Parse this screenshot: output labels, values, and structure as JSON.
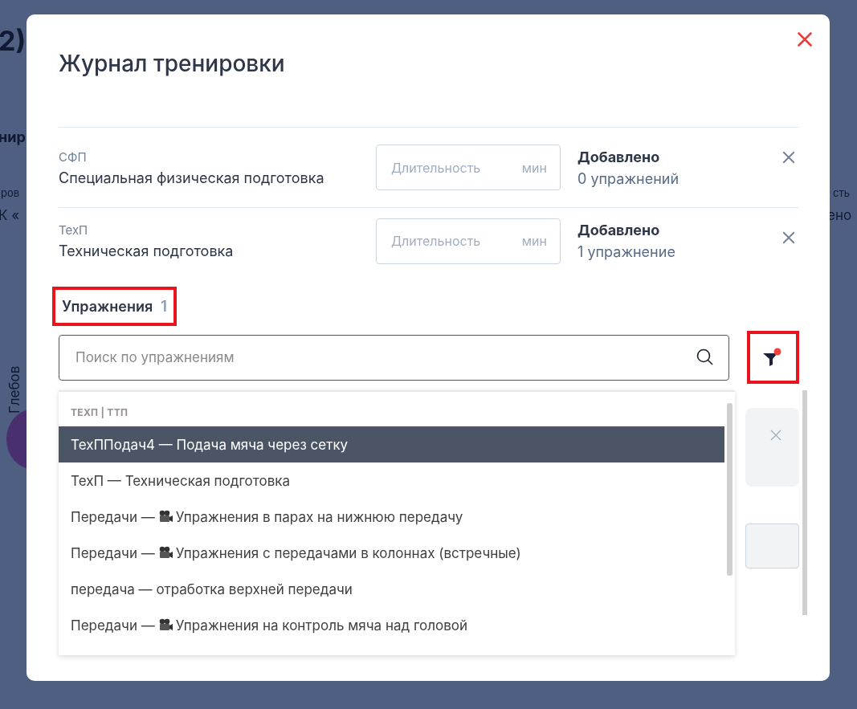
{
  "background": {
    "texts": [
      {
        "text": "2)",
        "kind": "heading"
      },
      {
        "text": "нир",
        "kind": "bold"
      },
      {
        "text": "ров",
        "kind": "label"
      },
      {
        "text": "К «",
        "kind": "value"
      },
      {
        "text": "сть",
        "kind": "label"
      },
      {
        "text": "ено",
        "kind": "value"
      },
      {
        "text": "Глебов",
        "kind": "vertical"
      }
    ]
  },
  "dialog": {
    "title": "Журнал тренировки",
    "sections": [
      {
        "code": "СФП",
        "name": "Специальная физическая подготовка",
        "duration": {
          "placeholder": "Длительность",
          "unit": "мин"
        },
        "status": "Добавлено",
        "count": "0 упражнений"
      },
      {
        "code": "ТехП",
        "name": "Техническая подготовка",
        "duration": {
          "placeholder": "Длительность",
          "unit": "мин"
        },
        "status": "Добавлено",
        "count": "1 упражнение"
      }
    ],
    "exercises": {
      "title": "Упражнения",
      "count": "1",
      "highlighted": true,
      "search": {
        "placeholder": "Поиск по упражнениям"
      },
      "filter": {
        "active": true,
        "highlighted": true
      },
      "dropdown": {
        "group": "ТЕХП | ТТП",
        "items": [
          {
            "lead": "ТехППодач4 —",
            "camera": false,
            "text": "Подача мяча через сетку",
            "selected": true
          },
          {
            "lead": "ТехП —",
            "camera": false,
            "text": "Техническая подготовка",
            "selected": false
          },
          {
            "lead": "Передачи —",
            "camera": true,
            "text": "Упражнения в парах на нижнюю передачу",
            "selected": false
          },
          {
            "lead": "Передачи —",
            "camera": true,
            "text": "Упражнения с передачами в колоннах (встречные)",
            "selected": false
          },
          {
            "lead": "передача —",
            "camera": false,
            "text": "отработка верхней передачи",
            "selected": false
          },
          {
            "lead": "Передачи —",
            "camera": true,
            "text": "Упражнения на контроль мяча над головой",
            "selected": false
          }
        ]
      }
    }
  }
}
